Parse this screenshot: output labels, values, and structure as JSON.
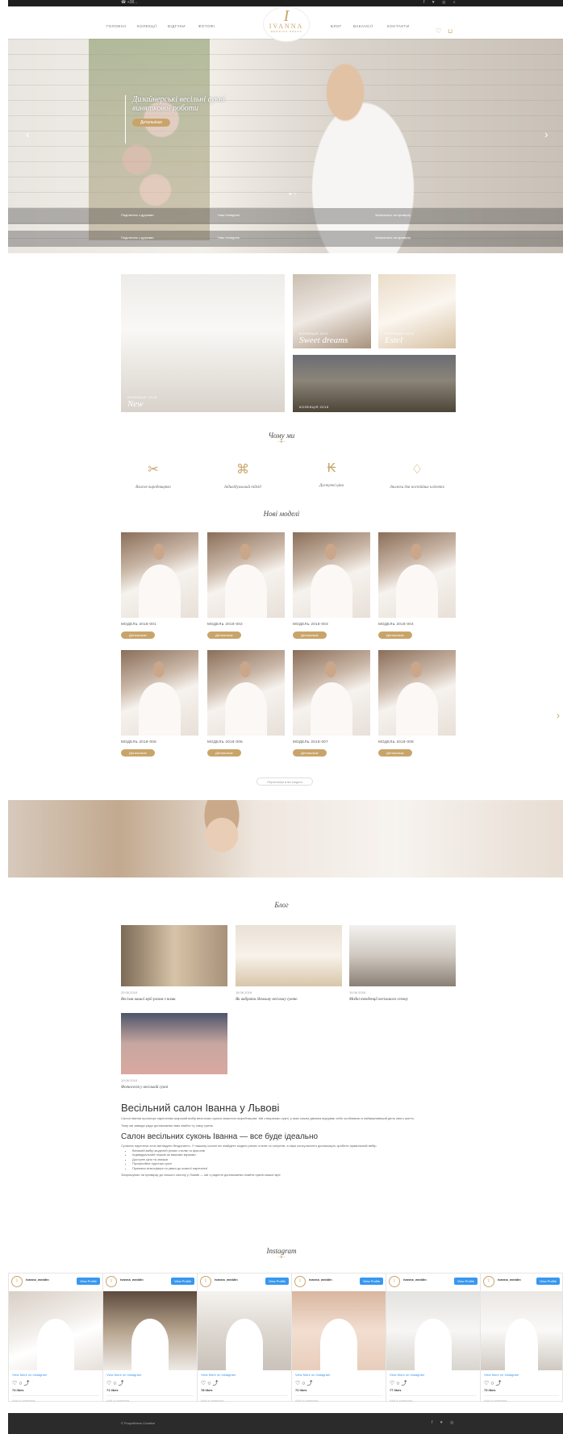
{
  "topbar": {
    "phone": "☎ +38...",
    "social": "f  ♥  ◎  ⌕"
  },
  "nav": {
    "left": [
      "ГОЛОВНА",
      "КОЛЕКЦІЇ",
      "ВІДГУКИ",
      "ФОТОФІ"
    ],
    "right": [
      "БЛОГ",
      "ВАКАНСІЇ",
      "КОНТАКТИ"
    ]
  },
  "logo": {
    "monogram": "I",
    "name": "IVANNA",
    "sub": "WEDDING DRESS"
  },
  "hero": {
    "caption": "Дизайнерські весільні сукні виняткової роботи",
    "button": "Детальніше",
    "strip1": [
      "Поділитись з друзями",
      "Наш Instagram",
      "Записатись на примірку"
    ],
    "strip2": [
      "Поділитись з друзями",
      "Наш Instagram",
      "Записатись на примірку"
    ]
  },
  "collections": [
    {
      "sub": "КОЛЕКЦІЯ 2018",
      "title": "New"
    },
    {
      "sub": "КОЛЕКЦІЯ 2017",
      "title": "Sweet dreams"
    },
    {
      "sub": "КОЛЕКЦІЯ 2016",
      "title": "Estel"
    },
    {
      "sub": "КОЛЕКЦІЯ 2015",
      "title": ""
    }
  ],
  "why": {
    "title": "Чому ми",
    "items": [
      "Власне виробництво",
      "Індивідуальний підхід",
      "Доступні ціни",
      "Знижки для постійних клієнтів"
    ]
  },
  "models": {
    "title": "Нові моделі",
    "button": "Детальніше",
    "items": [
      "МОДЕЛЬ 2018-001",
      "МОДЕЛЬ 2018-002",
      "МОДЕЛЬ 2018-003",
      "МОДЕЛЬ 2018-004",
      "МОДЕЛЬ 2018-005",
      "МОДЕЛЬ 2018-006",
      "МОДЕЛЬ 2018-007",
      "МОДЕЛЬ 2018-008"
    ],
    "more": "Переглянути всі моделі"
  },
  "blog": {
    "title": "Блог",
    "items": [
      {
        "date": "20.06.2018",
        "title": "Весілля вашої мрії разом з нами"
      },
      {
        "date": "18.06.2018",
        "title": "Як вибрати ідеальну весільну сукню"
      },
      {
        "date": "15.06.2018",
        "title": "Модні тенденції весільного сезону"
      },
      {
        "date": "10.06.2018",
        "title": "Фотосесія у весільній сукні"
      }
    ]
  },
  "seo": {
    "h1": "Весільний салон Іванна у Львові",
    "p1": "Салон Іванна пропонує наречeним широкий вибір весільних суконь власного виробництва. Ми створюємо сукні, у яких кожна дівчина відчуває себе особливою в найважливіший день свого життя.",
    "p2": "Тому ми завжди радо допоможемо вам знайти ту саму сукню.",
    "h2": "Салон весільних суконь Іванна — все буде ідеально",
    "p3": "Сучасна наречена хоче виглядати бездоганно. У нашому салоні ви знайдете моделі різних стилів та силуетів, а наші консультанти допоможуть зробити правильний вибір.",
    "list": [
      "Великий вибір моделей різних стилів та фасонів",
      "Індивідуальний пошив за вашими мірками",
      "Доступні ціни та знижки",
      "Професійна підгонка сукні",
      "Приємна атмосфера та увага до кожної нареченої"
    ],
    "p4": "Запрошуємо на примірку до нашого салону у Львові — ми з радістю допоможемо знайти сукню вашої мрії."
  },
  "instagram": {
    "title": "Instagram",
    "user": "ivanna_weddin",
    "view": "View Profile",
    "viewmore": "View More on Instagram",
    "comment": "Add a comment...",
    "likes": [
      "74 likes",
      "71 likes",
      "78 likes",
      "72 likes",
      "77 likes",
      "73 likes"
    ]
  },
  "footer": {
    "copy": "© Розроблено Creative",
    "social": "f  ♥  ◎"
  }
}
